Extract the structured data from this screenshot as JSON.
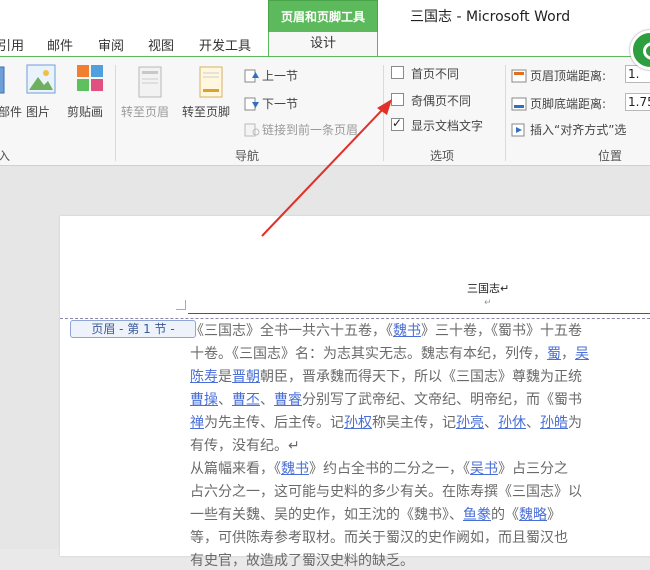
{
  "window": {
    "context_group_label": "页眉和页脚工具",
    "title": "三国志 - Microsoft Word"
  },
  "tabs": [
    {
      "label": "引用"
    },
    {
      "label": "邮件"
    },
    {
      "label": "审阅"
    },
    {
      "label": "视图"
    },
    {
      "label": "开发工具"
    },
    {
      "label": "设计"
    }
  ],
  "ribbon": {
    "insert": {
      "doc_parts_partial": "部件",
      "picture": "图片",
      "clip_art": "剪贴画",
      "group_label_partial": "入"
    },
    "navigation": {
      "goto_header": "转至页眉",
      "goto_footer": "转至页脚",
      "previous": "上一节",
      "next": "下一节",
      "link_previous": "链接到前一条页眉",
      "group_label": "导航"
    },
    "options": {
      "different_first_page": {
        "label": "首页不同",
        "checked": false
      },
      "different_odd_even": {
        "label": "奇偶页不同",
        "checked": false
      },
      "show_document_text": {
        "label": "显示文档文字",
        "checked": true
      },
      "group_label": "选项"
    },
    "position": {
      "header_from_top_label": "页眉顶端距离:",
      "header_from_top_value": "1.",
      "footer_from_bottom_label": "页脚底端距离:",
      "footer_from_bottom_value": "1.75",
      "insert_alignment_tab": "插入“对齐方式”选",
      "group_label": "位置"
    }
  },
  "document": {
    "header_text": "三国志",
    "header_para_mark": "↵",
    "header_para_mark2": "↵",
    "header_tag": "页眉 - 第 1 节 -",
    "lines": [
      [
        {
          "t": "《三国志》全书一共六十五卷，《"
        },
        {
          "t": "魏书",
          "link": true
        },
        {
          "t": "》三十卷，《蜀书》十五卷"
        }
      ],
      [
        {
          "t": "十卷。《三国志》名：为志其实无志。魏志有本纪，列传，"
        },
        {
          "t": "蜀",
          "link": true
        },
        {
          "t": "，"
        },
        {
          "t": "吴",
          "link": true
        }
      ],
      [
        {
          "t": "陈寿",
          "link": true
        },
        {
          "t": "是"
        },
        {
          "t": "晋朝",
          "link": true
        },
        {
          "t": "朝臣，晋承魏而得天下，所以《三国志》尊魏为正统"
        }
      ],
      [
        {
          "t": "曹操",
          "link": true
        },
        {
          "t": "、"
        },
        {
          "t": "曹丕",
          "link": true
        },
        {
          "t": "、"
        },
        {
          "t": "曹睿",
          "link": true
        },
        {
          "t": "分别写了武帝纪、文帝纪、明帝纪，而《蜀书"
        }
      ],
      [
        {
          "t": "禅",
          "link": true
        },
        {
          "t": "为先主传、后主传。记"
        },
        {
          "t": "孙权",
          "link": true
        },
        {
          "t": "称吴主传，记"
        },
        {
          "t": "孙亮",
          "link": true
        },
        {
          "t": "、"
        },
        {
          "t": "孙休",
          "link": true
        },
        {
          "t": "、"
        },
        {
          "t": "孙皓",
          "link": true
        },
        {
          "t": "为"
        }
      ],
      [
        {
          "t": "有传，没有纪。↵"
        }
      ],
      [
        {
          "t": "从篇幅来看，《"
        },
        {
          "t": "魏书",
          "link": true
        },
        {
          "t": "》约占全书的二分之一，《"
        },
        {
          "t": "吴书",
          "link": true
        },
        {
          "t": "》占三分之"
        }
      ],
      [
        {
          "t": "占六分之一，这可能与史料的多少有关。在陈寿撰《三国志》以"
        }
      ],
      [
        {
          "t": "一些有关魏、吴的史作，如王沈的《魏书》、"
        },
        {
          "t": "鱼豢",
          "link": true
        },
        {
          "t": "的《"
        },
        {
          "t": "魏略",
          "link": true
        },
        {
          "t": "》"
        }
      ],
      [
        {
          "t": "等，可供陈寿参考取材。而关于蜀汉的史作阙如，而且蜀汉也"
        }
      ],
      [
        {
          "t": "有史官，故造成了蜀汉史料的缺乏。"
        }
      ]
    ]
  }
}
